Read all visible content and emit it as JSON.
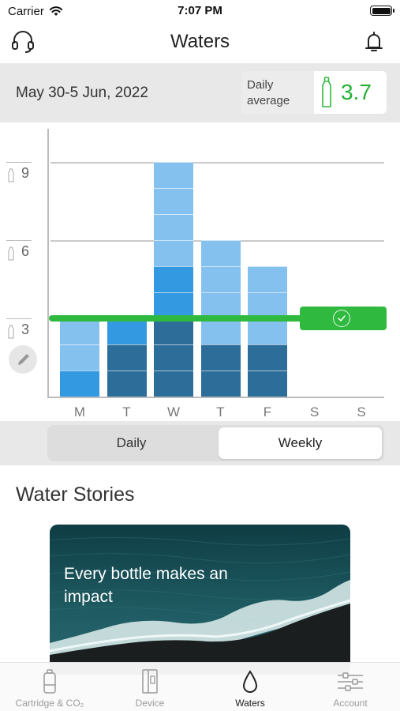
{
  "status_bar": {
    "carrier": "Carrier",
    "time": "7:07 PM"
  },
  "header": {
    "title": "Waters",
    "left_icon": "headset-icon",
    "right_icon": "bell-icon"
  },
  "summary": {
    "date_range": "May 30-5 Jun, 2022",
    "daily_average_label_line1": "Daily",
    "daily_average_label_line2": "average",
    "daily_average_value": "3.7",
    "accent_color": "#22b233"
  },
  "chart_data": {
    "type": "bar",
    "stacked": true,
    "categories": [
      "M",
      "T",
      "W",
      "T",
      "F",
      "S",
      "S"
    ],
    "y_ticks": [
      "3",
      "6",
      "9"
    ],
    "ylim": [
      0,
      9
    ],
    "goal_value": 3,
    "colors": {
      "light": "#85c1ef",
      "mid": "#3399e0",
      "dark": "#2c6d9a",
      "goal": "#2fba3f"
    },
    "series": [
      {
        "color_key": "dark",
        "values": [
          0,
          2,
          3,
          2,
          2,
          0,
          0
        ]
      },
      {
        "color_key": "mid",
        "values": [
          1,
          1,
          2,
          0,
          0,
          0,
          0
        ]
      },
      {
        "color_key": "light",
        "values": [
          2,
          0,
          4,
          4,
          3,
          0,
          0
        ]
      }
    ]
  },
  "toggle": {
    "daily": "Daily",
    "weekly": "Weekly",
    "selected": "Weekly"
  },
  "stories": {
    "title": "Water Stories",
    "card_text": "Every bottle makes an impact"
  },
  "tabs": [
    {
      "label": "Cartridge & CO₂",
      "icon": "cartridge-icon"
    },
    {
      "label": "Device",
      "icon": "device-icon"
    },
    {
      "label": "Waters",
      "icon": "water-drop-icon",
      "active": true
    },
    {
      "label": "Account",
      "icon": "sliders-icon"
    }
  ]
}
